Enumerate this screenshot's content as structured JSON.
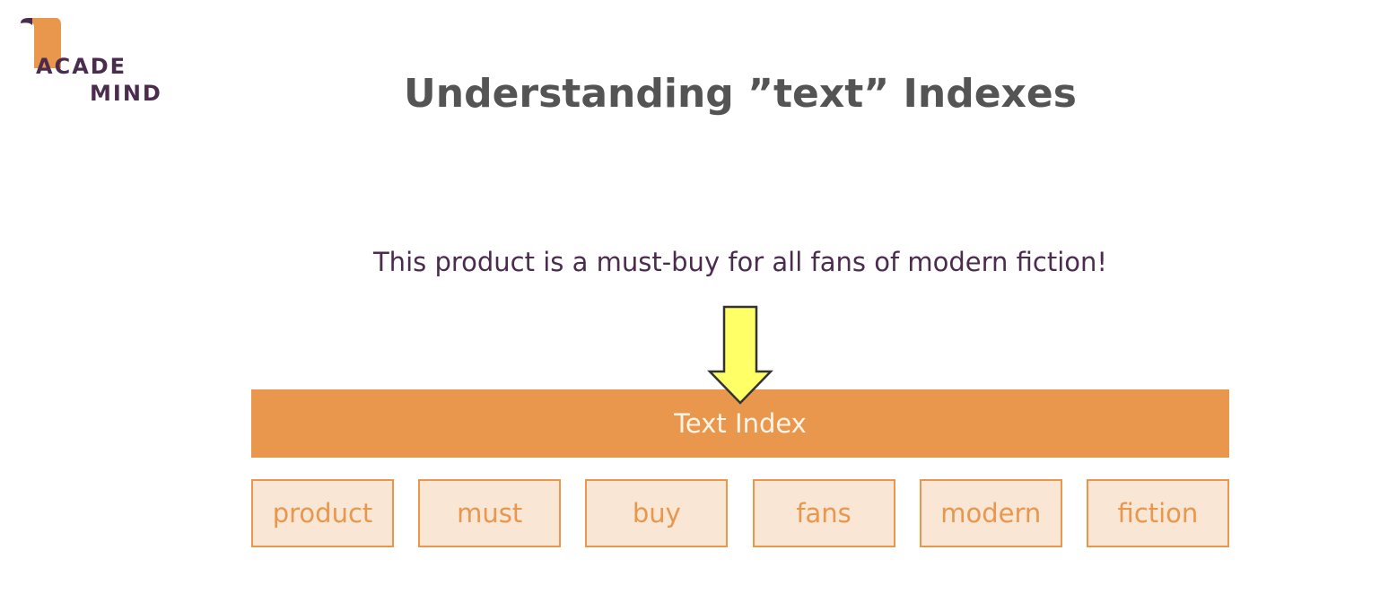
{
  "logo": {
    "line1": "ACADE",
    "line2": "MIND"
  },
  "title": "Understanding ”text” Indexes",
  "sentence": "This product is a must-buy for all fans of modern fiction!",
  "index_label": "Text Index",
  "tokens": [
    "product",
    "must",
    "buy",
    "fans",
    "modern",
    "fiction"
  ],
  "colors": {
    "logo": "#4b2c4f",
    "title": "#545454",
    "sentence": "#4b2c4f",
    "index_bar": "#e8974c",
    "index_text": "#fff4e8",
    "token_fill": "#f9e6d5",
    "token_text": "#e8974c",
    "arrow_fill": "#ffff66",
    "logo_mark": "#e8974c"
  }
}
